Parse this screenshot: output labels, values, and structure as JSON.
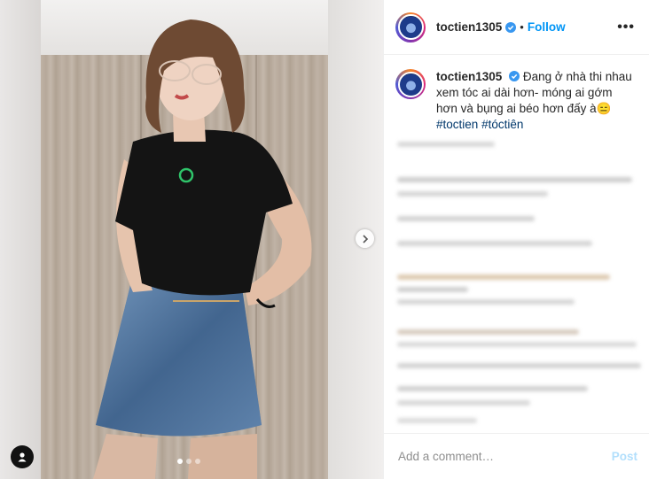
{
  "post": {
    "username": "toctien1305",
    "separator": "•",
    "follow_label": "Follow",
    "more_label": "•••",
    "caption_text": "Đang ở nhà thi nhau xem tóc ai dài hơn- móng ai gớm hơn và bụng ai béo hơn đấy à😑",
    "hashtags": [
      "#toctien",
      "#tóctiên"
    ]
  },
  "footer": {
    "comment_placeholder": "Add a comment…",
    "post_label": "Post"
  },
  "colors": {
    "link": "#0095f6",
    "hashtag": "#00376b",
    "post_disabled": "#b2dffc"
  },
  "carousel": {
    "slides": 3,
    "current": 1
  }
}
